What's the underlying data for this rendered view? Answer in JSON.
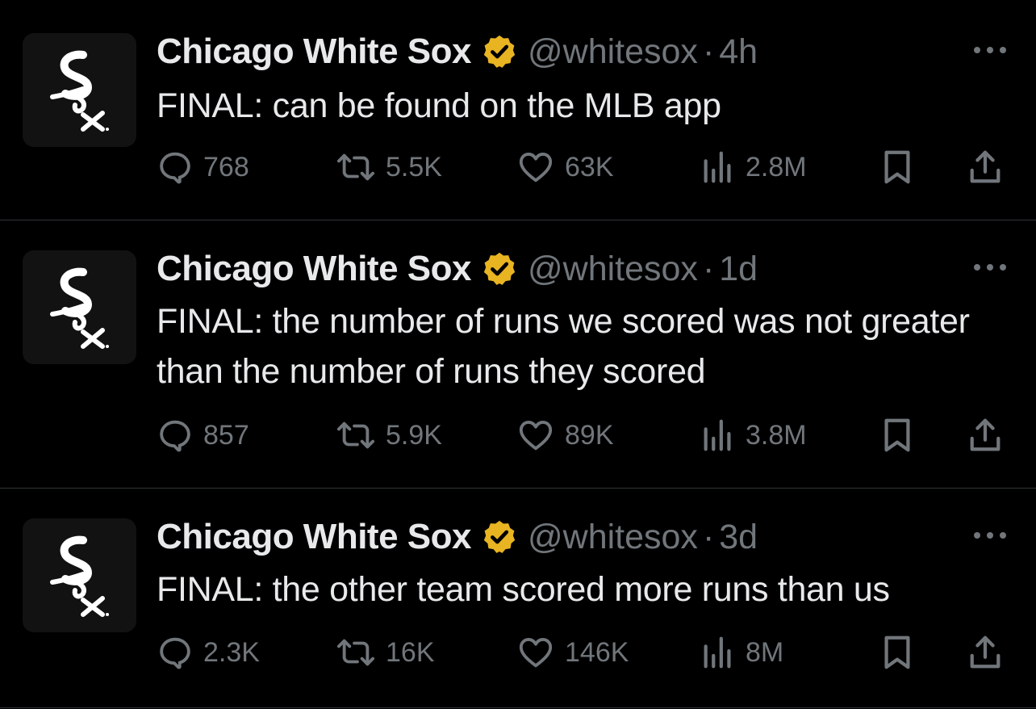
{
  "colors": {
    "background": "#000000",
    "primary_text": "#e7e9ea",
    "secondary_text": "#71767b",
    "verified_badge": "#e8b422",
    "divider": "#2f3336"
  },
  "tweets": [
    {
      "author": {
        "name": "Chicago White Sox",
        "handle": "@whitesox",
        "verified": true,
        "avatar_icon": "white-sox-logo-icon"
      },
      "separator": "·",
      "time": "4h",
      "text": "FINAL: can be found on the MLB app",
      "stats": {
        "replies": "768",
        "reposts": "5.5K",
        "likes": "63K",
        "views": "2.8M"
      }
    },
    {
      "author": {
        "name": "Chicago White Sox",
        "handle": "@whitesox",
        "verified": true,
        "avatar_icon": "white-sox-logo-icon"
      },
      "separator": "·",
      "time": "1d",
      "text": "FINAL: the number of runs we scored was not greater than the number of runs they scored",
      "stats": {
        "replies": "857",
        "reposts": "5.9K",
        "likes": "89K",
        "views": "3.8M"
      }
    },
    {
      "author": {
        "name": "Chicago White Sox",
        "handle": "@whitesox",
        "verified": true,
        "avatar_icon": "white-sox-logo-icon"
      },
      "separator": "·",
      "time": "3d",
      "text": "FINAL: the other team scored more runs than us",
      "stats": {
        "replies": "2.3K",
        "reposts": "16K",
        "likes": "146K",
        "views": "8M"
      }
    }
  ],
  "icons": {
    "reply": "reply-icon",
    "repost": "repost-icon",
    "like": "like-icon",
    "views": "views-icon",
    "bookmark": "bookmark-icon",
    "share": "share-icon",
    "more": "more-icon",
    "verified": "verified-badge-icon"
  }
}
